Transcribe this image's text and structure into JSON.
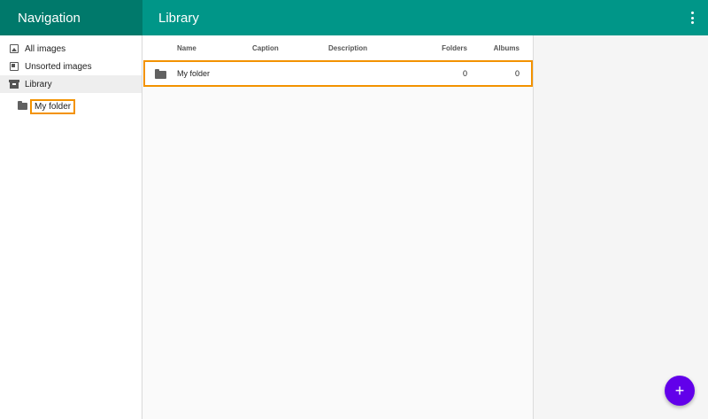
{
  "nav_header": {
    "title": "Navigation"
  },
  "main_header": {
    "title": "Library"
  },
  "sidebar": {
    "items": [
      {
        "label": "All images",
        "icon": "image-icon"
      },
      {
        "label": "Unsorted images",
        "icon": "unsorted-icon"
      },
      {
        "label": "Library",
        "icon": "archive-icon",
        "active": true
      }
    ],
    "subitems": [
      {
        "label": "My folder",
        "icon": "folder-icon",
        "highlighted": true
      }
    ]
  },
  "table": {
    "headers": {
      "name": "Name",
      "caption": "Caption",
      "description": "Description",
      "folders": "Folders",
      "albums": "Albums"
    },
    "rows": [
      {
        "name": "My folder",
        "caption": "",
        "description": "",
        "folders": "0",
        "albums": "0"
      }
    ]
  },
  "fab": {
    "label": "+"
  },
  "colors": {
    "header_dark": "#00796b",
    "header": "#009688",
    "fab": "#6200ea",
    "highlight": "#f39200"
  }
}
